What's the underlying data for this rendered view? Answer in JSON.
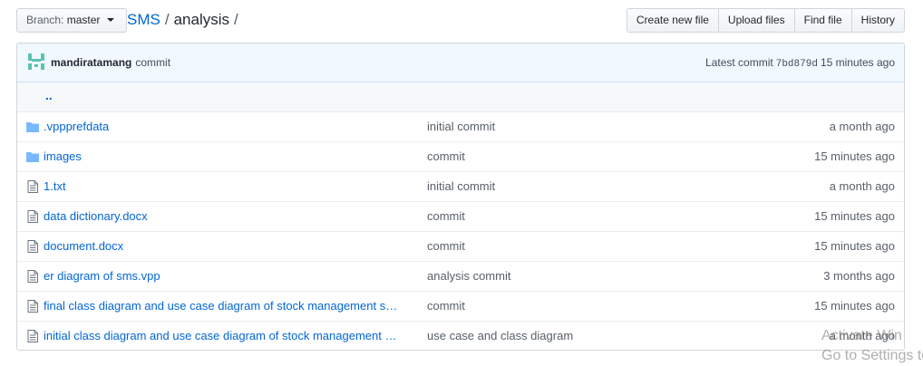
{
  "branch": {
    "prefix": "Branch:",
    "name": "master"
  },
  "breadcrumb": {
    "repo": "SMS",
    "separator": "/",
    "folder": "analysis",
    "trailing_sep": "/"
  },
  "actions": {
    "create_new_file": "Create new file",
    "upload_files": "Upload files",
    "find_file": "Find file",
    "history": "History"
  },
  "commit_tease": {
    "author": "mandiratamang",
    "message": "commit",
    "latest_label": "Latest commit",
    "sha": "7bd879d",
    "age": "15 minutes ago"
  },
  "parent_dir": "..",
  "files": [
    {
      "type": "folder",
      "icon": "folder-icon",
      "name": ".vppprefdata",
      "message": "initial commit",
      "age": "a month ago"
    },
    {
      "type": "folder",
      "icon": "folder-icon",
      "name": "images",
      "message": "commit",
      "age": "15 minutes ago"
    },
    {
      "type": "file",
      "icon": "file-icon",
      "name": "1.txt",
      "message": "initial commit",
      "age": "a month ago"
    },
    {
      "type": "file",
      "icon": "file-icon",
      "name": "data dictionary.docx",
      "message": "commit",
      "age": "15 minutes ago"
    },
    {
      "type": "file",
      "icon": "file-icon",
      "name": "document.docx",
      "message": "commit",
      "age": "15 minutes ago"
    },
    {
      "type": "file",
      "icon": "file-icon",
      "name": "er diagram of sms.vpp",
      "message": "analysis commit",
      "age": "3 months ago"
    },
    {
      "type": "file",
      "icon": "file-icon",
      "name": "final class diagram and use case diagram of stock management s…",
      "message": "commit",
      "age": "15 minutes ago"
    },
    {
      "type": "file",
      "icon": "file-icon",
      "name": "initial class diagram and use case diagram of stock management …",
      "message": "use case and class diagram",
      "age": "a month ago"
    }
  ],
  "watermark": {
    "line1": "Activate Win",
    "line2": "Go to Settings to"
  },
  "colors": {
    "link": "#0366d6",
    "muted": "#586069",
    "tease_bg": "#f1f8ff",
    "folder": "#79b8ff"
  }
}
